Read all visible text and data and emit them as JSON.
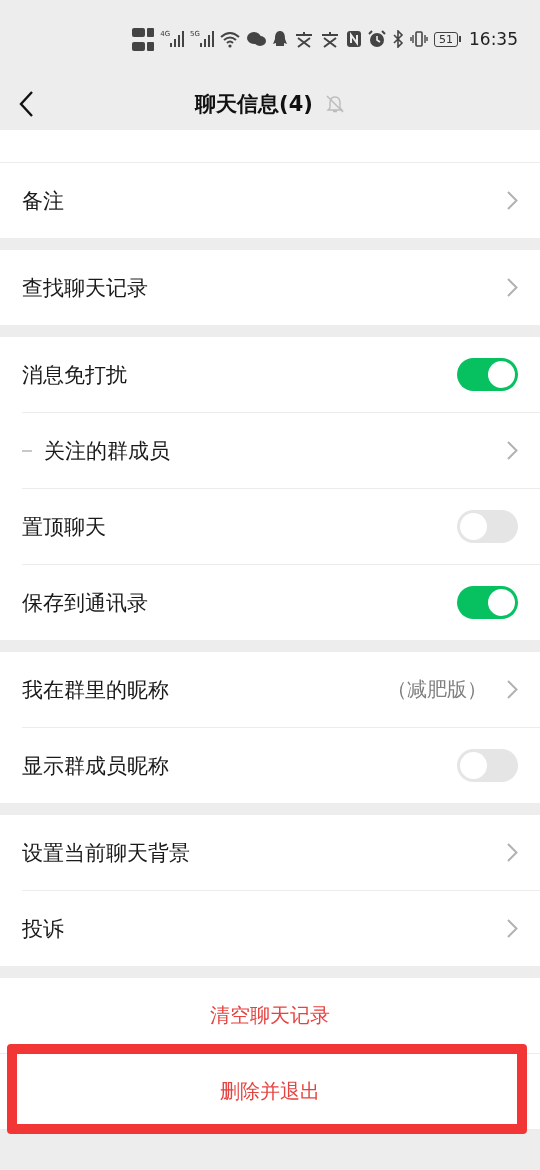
{
  "status_bar": {
    "network_1": "4G",
    "network_2": "5G",
    "battery": "51",
    "time": "16:35"
  },
  "header": {
    "title": "聊天信息(4)",
    "muted": true
  },
  "groups": [
    [
      {
        "kind": "link",
        "label": "备注"
      }
    ],
    [
      {
        "kind": "link",
        "label": "查找聊天记录"
      }
    ],
    [
      {
        "kind": "toggle",
        "label": "消息免打扰",
        "on": true
      },
      {
        "kind": "sublink",
        "label": "关注的群成员"
      },
      {
        "kind": "toggle",
        "label": "置顶聊天",
        "on": false
      },
      {
        "kind": "toggle",
        "label": "保存到通讯录",
        "on": true
      }
    ],
    [
      {
        "kind": "link",
        "label": "我在群里的昵称",
        "value": "（减肥版）"
      },
      {
        "kind": "toggle",
        "label": "显示群成员昵称",
        "on": false
      }
    ],
    [
      {
        "kind": "link",
        "label": "设置当前聊天背景"
      },
      {
        "kind": "link",
        "label": "投诉"
      }
    ]
  ],
  "actions": [
    {
      "label": "清空聊天记录",
      "highlighted": false
    },
    {
      "label": "删除并退出",
      "highlighted": true
    }
  ]
}
